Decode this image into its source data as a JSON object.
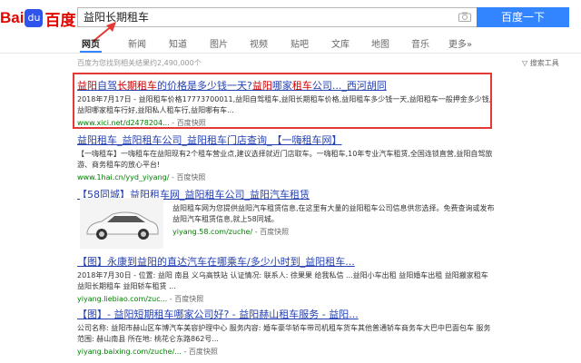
{
  "logo": {
    "bai": "Bai",
    "paw": "du",
    "du": "百度"
  },
  "search": {
    "value": "益阳长期租车",
    "button": "百度一下"
  },
  "tabs": [
    "网页",
    "新闻",
    "知道",
    "图片",
    "视频",
    "贴吧",
    "文库",
    "地图",
    "音乐",
    "更多»"
  ],
  "result_count": "百度为您找到相关结果约2,490,000个",
  "tools": "搜索工具",
  "results": [
    {
      "title_parts": [
        "益阳",
        "自驾",
        "长期租车",
        "的价格是多少钱一天?",
        "益阳",
        "哪家",
        "租车",
        "公司...",
        "_西河胡同"
      ],
      "text": "2018年7月17日 - 益阳租车价格17773700011,益阳自驾租车,益阳长期租车价格,益阳租车多少钱一天,益阳租车一般押金多少钱,益阳哪家租车行好,益阳私人租车行,益阳哪有车...",
      "url": "www.xici.net/d2478204...",
      "cache": "- 百度快照"
    },
    {
      "title": "益阳租车_益阳租车公司_益阳租车门店查询_【一嗨租车网】",
      "text": "【一嗨租车】一嗨租车在益阳现有2个租车营业点,建议选择就近门店取车。一嗨租车,10年专业汽车租赁,全国连锁直营,益阳自驾旅游、商务租车的放心平台!",
      "url": "www.1hai.cn/yyd_yiyang/",
      "cache": "- 百度快照"
    },
    {
      "title": "【58同城】益阳租车网_益阳租车公司_益阳汽车租赁",
      "text": "益阳租车网为您提供益阳汽车租赁信息,在这里有大量的益阳租车公司信息供您选择。免费查询或发布益阳汽车租赁信息,就上58同城。",
      "url": "yiyang.58.com/zuche/",
      "cache": "- 百度快照"
    },
    {
      "title": "【图】永康到益阳的直达汽车在哪乘车/多少小时到_益阳租车...",
      "text": "2018年7月30日 - 位置: 益阳 南县 义乌高铁站 认证情况: 联系人: 徐果果 给我私信 ...益阳小车出租 益阳婚车出租 益阳搬家租车 益阳长期租车 益阳轿车租赁 ...",
      "url": "yiyang.liebiao.com/zuc...",
      "cache": "- 百度快照"
    },
    {
      "title": "【图】- 益阳短期租车哪家公司好? - 益阳赫山租车服务 - 益阳...",
      "text": "公司名称: 益阳市赫山区车博汽车美容护理中心 服务内容: 婚车豪华轿车带司机租车货车其他普通轿车商务车大巴中巴面包车 服务范围: 赫山南县 所在地: 桃花仑东路862号...",
      "url": "yiyang.baixing.com/zuche/...",
      "cache": "- 百度快照"
    }
  ],
  "colors": {
    "link": "#2440b3",
    "highlight": "#cc0000",
    "url": "#008000",
    "button": "#3385ff",
    "box": "#e53935"
  }
}
